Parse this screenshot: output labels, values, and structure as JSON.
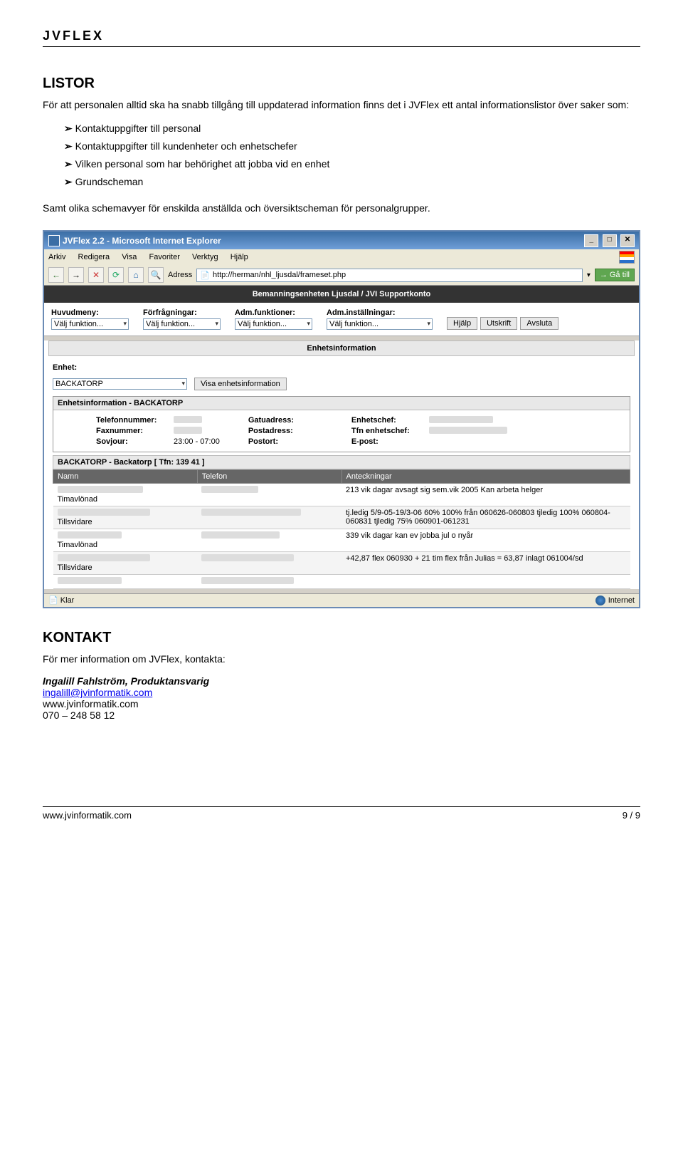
{
  "header": {
    "brand": "JVFLEX"
  },
  "sections": {
    "listor": {
      "heading": "LISTOR",
      "intro": "För att personalen alltid ska ha snabb tillgång till uppdaterad information finns det i JVFlex ett antal informationslistor över saker som:",
      "bullets": [
        "Kontaktuppgifter till personal",
        "Kontaktuppgifter till kundenheter och enhetschefer",
        "Vilken personal som har behörighet att jobba vid en enhet",
        "Grundscheman"
      ],
      "outro": "Samt olika schemavyer för enskilda anställda och översiktscheman för personalgrupper."
    },
    "kontakt": {
      "heading": "KONTAKT",
      "line1": "För mer information om JVFlex, kontakta:",
      "name": "Ingalill Fahlström, Produktansvarig",
      "email": "ingalill@jvinformatik.com",
      "web": "www.jvinformatik.com",
      "phone": "070 – 248 58 12"
    }
  },
  "screenshot": {
    "window_title": "JVFlex 2.2 - Microsoft Internet Explorer",
    "menu": {
      "arkiv": "Arkiv",
      "redigera": "Redigera",
      "visa": "Visa",
      "favoriter": "Favoriter",
      "verktyg": "Verktyg",
      "hjalp": "Hjälp"
    },
    "toolbar": {
      "back": "←",
      "forward": "→",
      "stop": "✕",
      "refresh": "⟳",
      "home": "⌂",
      "search": "🔍",
      "address_label": "Adress",
      "url": "http://herman/nhl_ljusdal/frameset.php",
      "go": "Gå till"
    },
    "app_header": "Bemanningsenheten Ljusdal / JVI Supportkonto",
    "nav": {
      "labels": {
        "huvud": "Huvudmeny:",
        "forf": "Förfrågningar:",
        "admf": "Adm.funktioner:",
        "admi": "Adm.inställningar:"
      },
      "placeholder": "Välj funktion...",
      "btns": {
        "hjalp": "Hjälp",
        "utskrift": "Utskrift",
        "avsluta": "Avsluta"
      }
    },
    "section_title": "Enhetsinformation",
    "enhet": {
      "label": "Enhet:",
      "value": "BACKATORP",
      "show_btn": "Visa enhetsinformation"
    },
    "info_panel_title": "Enhetsinformation - BACKATORP",
    "info_rows": {
      "left": [
        {
          "lab": "Telefonnummer:",
          "val": ""
        },
        {
          "lab": "Faxnummer:",
          "val": ""
        },
        {
          "lab": "Sovjour:",
          "val": "23:00 - 07:00"
        }
      ],
      "mid": [
        {
          "lab": "Gatuadress:",
          "val": ""
        },
        {
          "lab": "Postadress:",
          "val": ""
        },
        {
          "lab": "Postort:",
          "val": ""
        }
      ],
      "right": [
        {
          "lab": "Enhetschef:",
          "val": ""
        },
        {
          "lab": "Tfn enhetschef:",
          "val": ""
        },
        {
          "lab": "E-post:",
          "val": ""
        }
      ]
    },
    "table_caption": "BACKATORP - Backatorp [ Tfn: 139 41 ]",
    "table_headers": {
      "namn": "Namn",
      "telefon": "Telefon",
      "ant": "Anteckningar"
    },
    "table_rows": [
      {
        "sub": "Timavlönad",
        "note": "213 vik dagar avsagt sig sem.vik 2005 Kan arbeta helger"
      },
      {
        "sub": "Tillsvidare",
        "note": "tj.ledig 5/9-05-19/3-06 60% 100% från 060626-060803 tjledig 100% 060804-060831 tjledig 75% 060901-061231"
      },
      {
        "sub": "Timavlönad",
        "note": "339 vik dagar kan ev jobba jul o nyår"
      },
      {
        "sub": "Tillsvidare",
        "note": "+42,87 flex 060930 + 21 tim flex från Julias = 63,87 inlagt 061004/sd"
      }
    ],
    "status": {
      "left": "Klar",
      "right": "Internet"
    }
  },
  "footer": {
    "left": "www.jvinformatik.com",
    "right": "9 / 9"
  }
}
